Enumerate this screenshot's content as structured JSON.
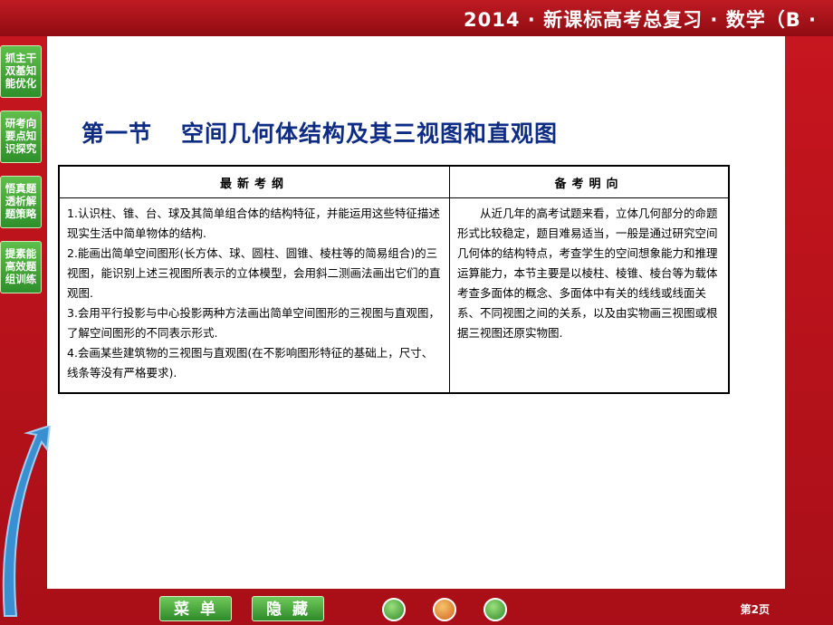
{
  "header": {
    "title": "2014 · 新课标高考总复习 · 数学（B ·"
  },
  "sidebar": {
    "items": [
      {
        "label": "抓主干双基知能优化"
      },
      {
        "label": "研考向要点知识探究"
      },
      {
        "label": "悟真题透析解题策略"
      },
      {
        "label": "提素能高效题组训练"
      }
    ]
  },
  "main": {
    "title_part1": "第一节",
    "title_part2": "空间几何体结构及其三视图和直观图",
    "table": {
      "headers": [
        "最新考纲",
        "备考明向"
      ],
      "left_items": [
        "1.认识柱、锥、台、球及其简单组合体的结构特征，并能运用这些特征描述现实生活中简单物体的结构.",
        "2.能画出简单空间图形(长方体、球、圆柱、圆锥、棱柱等的简易组合)的三视图，能识别上述三视图所表示的立体模型，会用斜二测画法画出它们的直观图.",
        "3.会用平行投影与中心投影两种方法画出简单空间图形的三视图与直观图，了解空间图形的不同表示形式.",
        "4.会画某些建筑物的三视图与直观图(在不影响图形特征的基础上，尺寸、线条等没有严格要求)."
      ],
      "right_text": "从近几年的高考试题来看，立体几何部分的命题形式比较稳定，题目难易适当，一般是通过研究空间几何体的结构特点，考查学生的空间想象能力和推理运算能力，本节主要是以棱柱、棱锥、棱台等为载体考查多面体的概念、多面体中有关的线线或线面关系、不同视图之间的关系，以及由实物画三视图或根据三视图还原实物图."
    }
  },
  "footer": {
    "menu_label": "菜单",
    "hide_label": "隐藏",
    "page_label": "第2页"
  },
  "colors": {
    "frame": "#b3131c",
    "title": "#0e2c84",
    "button_green": "#2e8a2a"
  }
}
